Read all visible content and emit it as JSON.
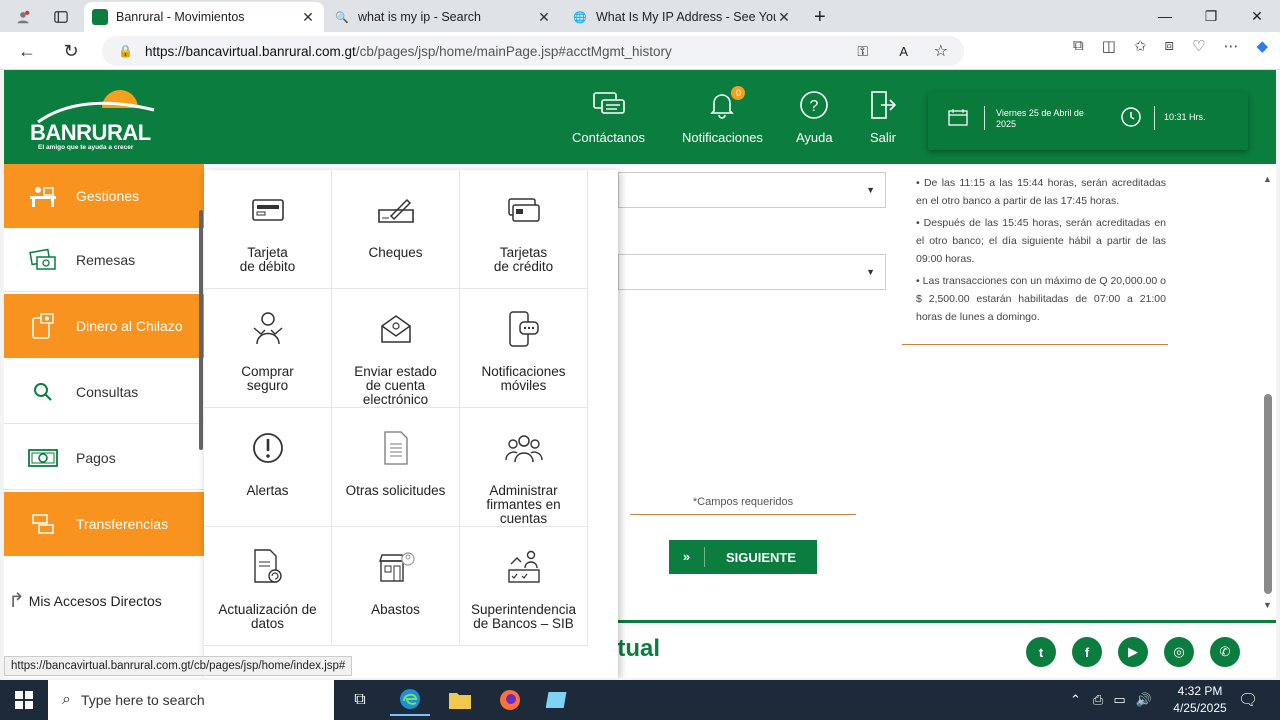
{
  "browser": {
    "tabs": [
      {
        "title": "Banrural - Movimientos",
        "active": true
      },
      {
        "title": "what is my ip - Search",
        "active": false
      },
      {
        "title": "What Is My IP Address - See Your",
        "active": false
      }
    ],
    "url_host": "https://bancavirtual.banrural.com.gt",
    "url_path": "/cb/pages/jsp/home/mainPage.jsp#acctMgmt_history"
  },
  "header": {
    "logo_name": "BANRURAL",
    "logo_slogan": "El amigo que te ayuda a crecer",
    "nav": [
      {
        "label": "Contáctanos",
        "icon": "chat-icon"
      },
      {
        "label": "Notificaciones",
        "icon": "bell-icon",
        "badge": "0"
      },
      {
        "label": "Ayuda",
        "icon": "help-icon"
      },
      {
        "label": "Salir",
        "icon": "exit-icon"
      }
    ],
    "date": "Viernes 25 de Abril de 2025",
    "time": "10:31 Hrs."
  },
  "sidebar": {
    "items": [
      {
        "label": "Gestiones",
        "highlight": true
      },
      {
        "label": "Remesas",
        "highlight": false
      },
      {
        "label": "Dinero al Chilazo",
        "highlight": true
      },
      {
        "label": "Consultas",
        "highlight": false
      },
      {
        "label": "Pagos",
        "highlight": false
      },
      {
        "label": "Transferencias",
        "highlight": true
      }
    ],
    "accesos": "Mis Accesos Directos"
  },
  "menu": {
    "items": [
      {
        "label": "Tarjeta\nde débito",
        "icon": "debit-card-icon"
      },
      {
        "label": "Cheques",
        "icon": "cheque-icon"
      },
      {
        "label": "Tarjetas\nde crédito",
        "icon": "credit-card-icon"
      },
      {
        "label": "Comprar\nseguro",
        "icon": "insurance-icon"
      },
      {
        "label": "Enviar estado\nde cuenta\nelectrónico",
        "icon": "email-statement-icon"
      },
      {
        "label": "Notificaciones\nmóviles",
        "icon": "mobile-notification-icon"
      },
      {
        "label": "Alertas",
        "icon": "alert-icon"
      },
      {
        "label": "Otras solicitudes",
        "icon": "document-list-icon"
      },
      {
        "label": "Administrar\nfirmantes en\ncuentas",
        "icon": "users-icon"
      },
      {
        "label": "Actualización de\ndatos",
        "icon": "update-data-icon"
      },
      {
        "label": "Abastos",
        "icon": "store-icon"
      },
      {
        "label": "Superintendencia\nde Bancos – SIB",
        "icon": "checklist-icon"
      }
    ]
  },
  "form": {
    "rules": [
      "• De las 11:15 a las 15:44 horas, serán acreditadas en el otro banco a partir de las 17:45 horas.",
      "• Después de las 15:45 horas, serán acreditadas en el otro banco; el día siguiente hábil a partir de las 09:00 horas.",
      "• Las transacciones con un máximo de Q 20,000.00 o $ 2,500.00 estarán habilitadas de 07:00 a 21:00 horas de lunes a domingo."
    ],
    "required_note": "*Campos requeridos",
    "next_button": "SIGUIENTE"
  },
  "footer": {
    "brand": "rtual",
    "social": [
      "twitter-icon",
      "facebook-icon",
      "youtube-icon",
      "instagram-icon",
      "whatsapp-icon"
    ]
  },
  "statusbar_url": "https://bancavirtual.banrural.com.gt/cb/pages/jsp/home/index.jsp#",
  "taskbar": {
    "search_placeholder": "Type here to search",
    "time": "4:32 PM",
    "date": "4/25/2025"
  },
  "colors": {
    "brand_green": "#0b7d3e",
    "brand_orange": "#f7931e"
  }
}
